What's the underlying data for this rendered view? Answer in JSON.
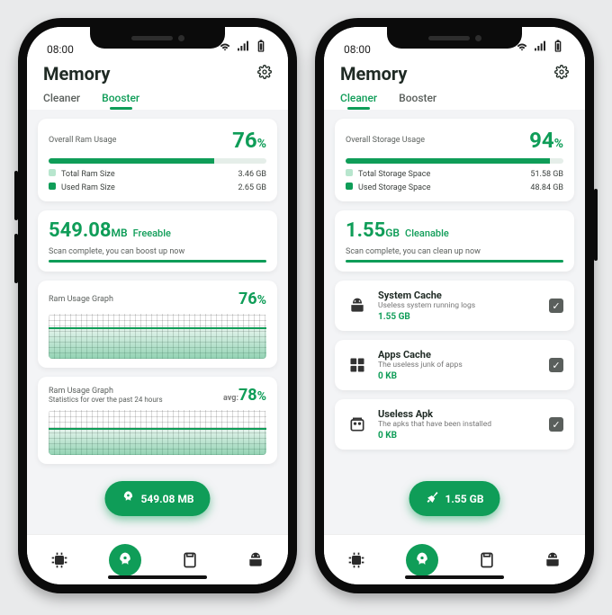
{
  "status": {
    "time": "08:00"
  },
  "header": {
    "title": "Memory"
  },
  "tabs": {
    "cleaner": "Cleaner",
    "booster": "Booster"
  },
  "left": {
    "usage": {
      "title": "Overall Ram Usage",
      "percent": "76",
      "percent_suffix": "%",
      "bar_pct": 76,
      "total_label": "Total Ram Size",
      "total_value": "3.46 GB",
      "used_label": "Used Ram Size",
      "used_value": "2.65 GB"
    },
    "freeable": {
      "value": "549.08",
      "unit": "MB",
      "suffix": "Freeable",
      "msg": "Scan complete, you can boost up now"
    },
    "graph1": {
      "title": "Ram Usage Graph",
      "percent": "76",
      "suffix": "%"
    },
    "graph2": {
      "title": "Ram Usage Graph",
      "subtitle": "Statistics for over the past 24 hours",
      "avg_label": "avg:",
      "avg_value": "78",
      "suffix": "%"
    },
    "fab": {
      "label": "549.08 MB"
    }
  },
  "right": {
    "usage": {
      "title": "Overall Storage Usage",
      "percent": "94",
      "percent_suffix": "%",
      "bar_pct": 94,
      "total_label": "Total Storage Space",
      "total_value": "51.58 GB",
      "used_label": "Used Storage Space",
      "used_value": "48.84 GB"
    },
    "cleanable": {
      "value": "1.55",
      "unit": "GB",
      "suffix": "Cleanable",
      "msg": "Scan complete, you can clean up now"
    },
    "items": [
      {
        "title": "System Cache",
        "sub": "Useless system running logs",
        "size": "1.55 GB"
      },
      {
        "title": "Apps Cache",
        "sub": "The useless junk of apps",
        "size": "0 KB"
      },
      {
        "title": "Useless Apk",
        "sub": "The apks that have been installed",
        "size": "0 KB"
      }
    ],
    "fab": {
      "label": "1.55 GB"
    }
  }
}
